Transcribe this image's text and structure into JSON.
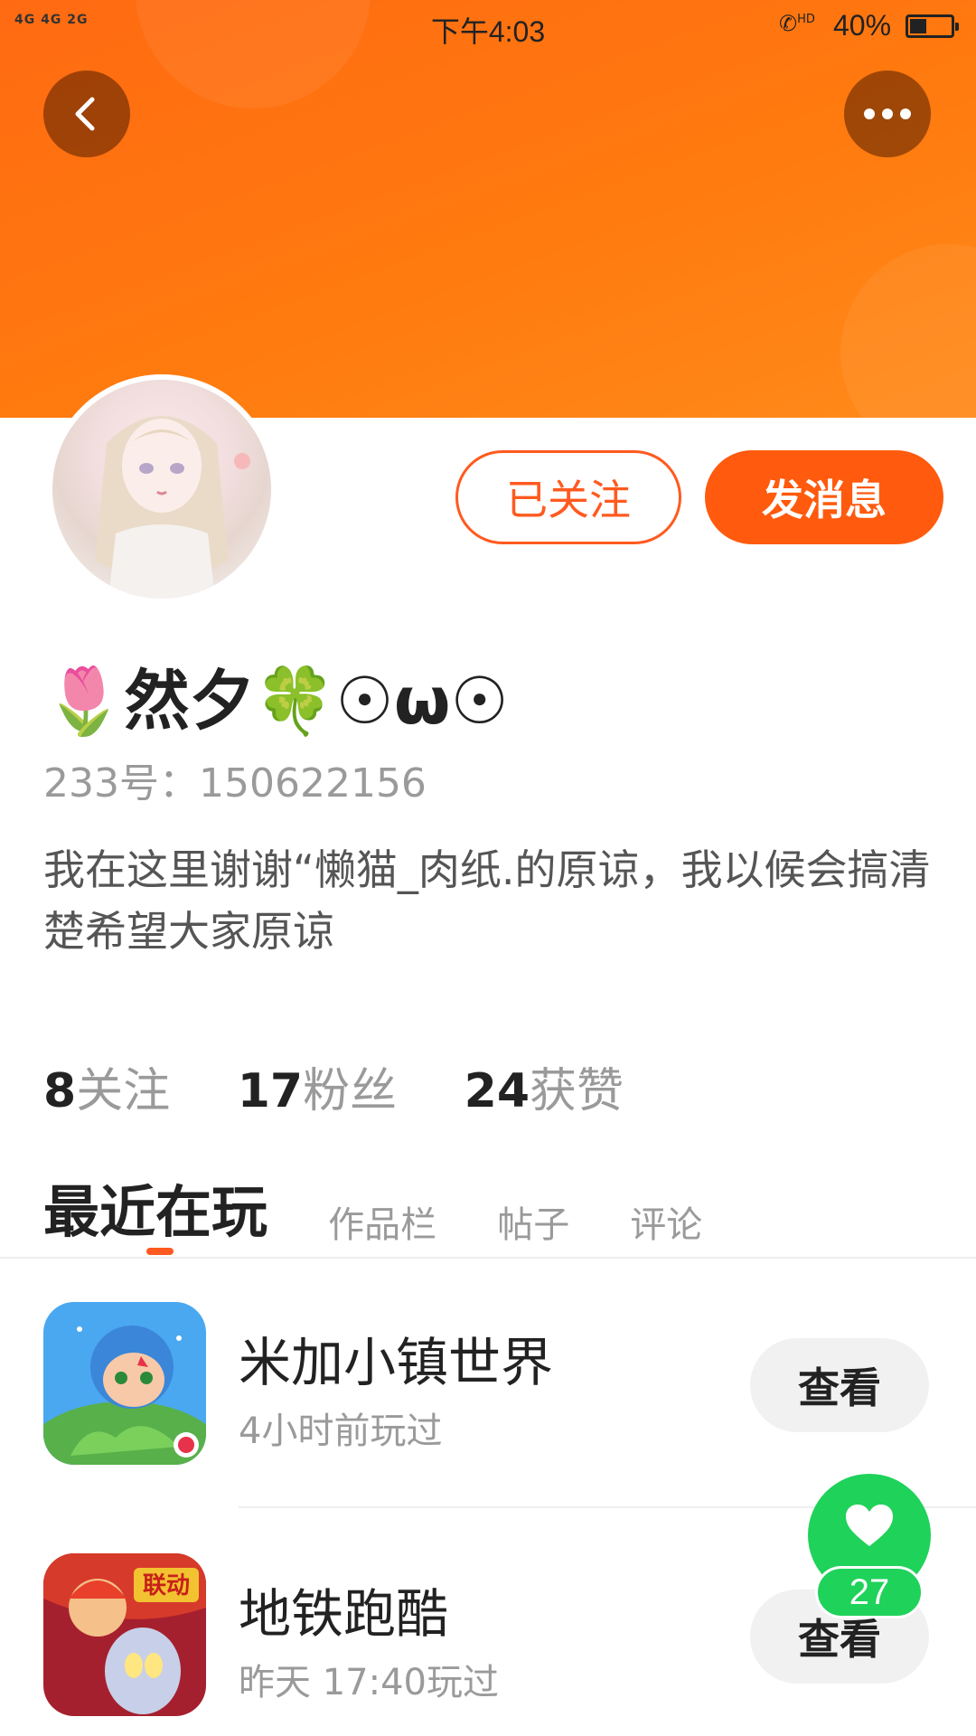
{
  "status_bar": {
    "network": "4G 4G  2G",
    "time": "下午4:03",
    "call_label": "HD",
    "battery": "40%",
    "battery_level": 0.4
  },
  "profile": {
    "nickname": "🌷然夕🍀☉ω☉",
    "user_id": "233号：150622156",
    "bio": "我在这里谢谢“懒猫_肉纸.的原谅，我以候会搞清楚希望大家原谅",
    "follow_label": "已关注",
    "message_label": "发消息"
  },
  "stats": [
    {
      "value": "8",
      "label": "关注"
    },
    {
      "value": "17",
      "label": "粉丝"
    },
    {
      "value": "24",
      "label": "获赞"
    }
  ],
  "tabs": [
    {
      "label": "最近在玩",
      "active": true
    },
    {
      "label": "作品栏",
      "active": false
    },
    {
      "label": "帖子",
      "active": false
    },
    {
      "label": "评论",
      "active": false
    }
  ],
  "games": [
    {
      "name": "米加小镇世界",
      "time": "4小时前玩过",
      "action": "查看"
    },
    {
      "name": "地铁跑酷",
      "time": "昨天 17:40玩过",
      "action": "查看",
      "badge": "联动"
    }
  ],
  "like": {
    "count": "27"
  },
  "colors": {
    "accent": "#ff5a1f",
    "header": "#ff7a0f",
    "like": "#1fd25a"
  }
}
